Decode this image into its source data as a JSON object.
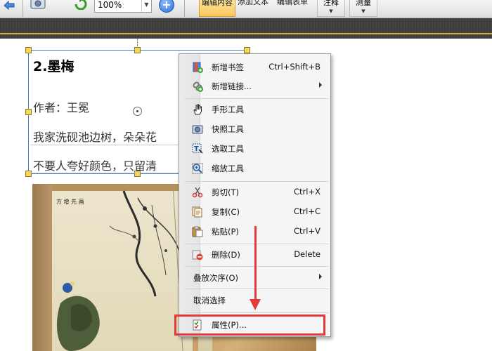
{
  "toolbar": {
    "zoom_value": "100%",
    "tab_edit_content": "编辑内容",
    "tab_add_text": "添加文本",
    "tab_edit_form": "编辑表单",
    "annotate": "注释",
    "measure": "测量"
  },
  "document": {
    "poem_title": "2.墨梅",
    "author_line": "作者：王冕",
    "line1": "我家洗砚池边树，朵朵花",
    "line2": "不要人夸好颜色，只留清"
  },
  "context_menu": {
    "items": [
      {
        "label": "新增书签",
        "shortcut": "Ctrl+Shift+B",
        "icon": "bookmark-add-icon"
      },
      {
        "label": "新增链接...",
        "icon": "link-add-icon"
      },
      {
        "label": "手形工具",
        "icon": "hand-tool-icon"
      },
      {
        "label": "快照工具",
        "icon": "snapshot-icon"
      },
      {
        "label": "选取工具",
        "icon": "select-text-icon"
      },
      {
        "label": "缩放工具",
        "icon": "zoom-tool-icon"
      },
      {
        "label": "剪切(T)",
        "shortcut": "Ctrl+X",
        "icon": "scissors-icon"
      },
      {
        "label": "复制(C)",
        "shortcut": "Ctrl+C",
        "icon": "copy-icon"
      },
      {
        "label": "粘贴(P)",
        "shortcut": "Ctrl+V",
        "icon": "paste-icon"
      },
      {
        "label": "删除(D)",
        "shortcut": "Delete",
        "icon": "delete-icon"
      },
      {
        "label": "叠放次序(O)"
      },
      {
        "label": "取消选择"
      },
      {
        "label": "属性(P)...",
        "icon": "properties-icon"
      }
    ]
  },
  "colors": {
    "highlight_red": "#e23a3a",
    "selection_blue": "#3a7fd5",
    "active_tab": "#f7c75c"
  }
}
